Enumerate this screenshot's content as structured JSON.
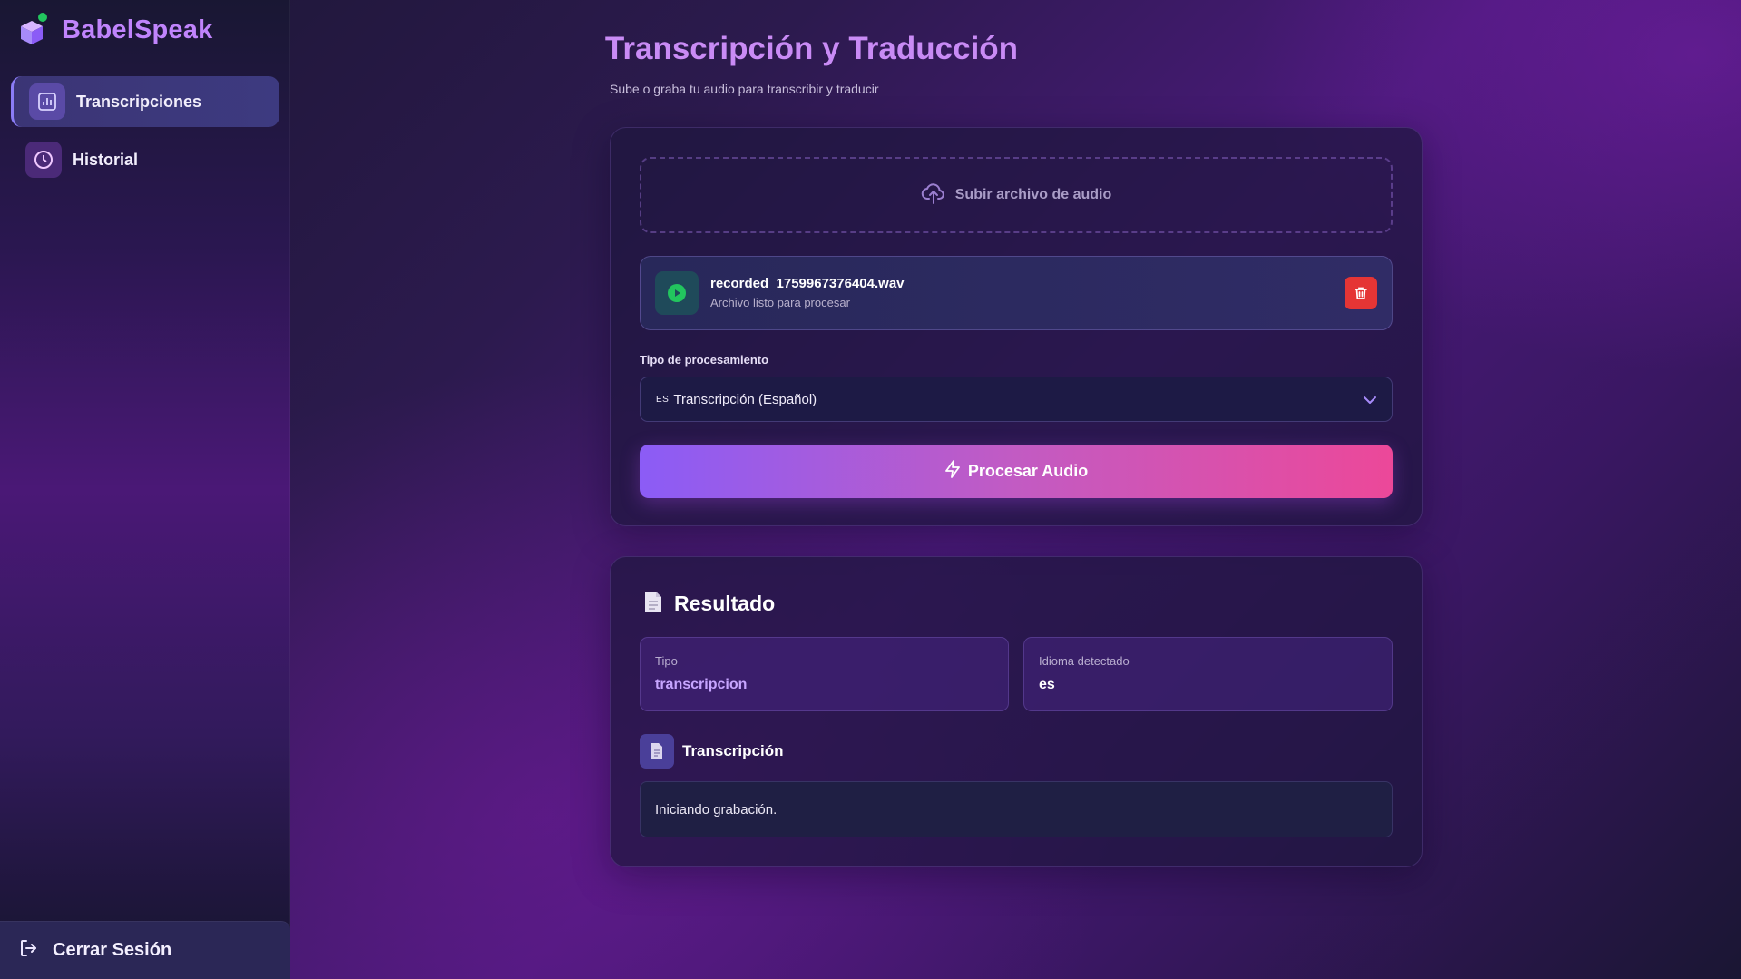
{
  "app": {
    "name": "BabelSpeak",
    "accent": "#c084fc"
  },
  "sidebar": {
    "items": [
      {
        "label": "Transcripciones",
        "icon": "bar-chart-icon",
        "active": true
      },
      {
        "label": "Historial",
        "icon": "clock-icon",
        "active": false
      }
    ],
    "logout_label": "Cerrar Sesión"
  },
  "header": {
    "title": "Transcripción y Traducción",
    "subtitle": "Sube o graba tu audio para transcribir y traducir"
  },
  "upload": {
    "label": "Subir archivo de audio",
    "icon": "upload-cloud-icon"
  },
  "file": {
    "name": "recorded_1759967376404.wav",
    "status": "Archivo listo para procesar"
  },
  "processing": {
    "label": "Tipo de procesamiento",
    "selected_flag": "ES",
    "selected_value": "Transcripción (Español)",
    "button_label": "Procesar Audio"
  },
  "result": {
    "title": "Resultado",
    "tipo_key": "Tipo",
    "tipo_value": "transcripcion",
    "idioma_key": "Idioma detectado",
    "idioma_value": "es",
    "transcription_title": "Transcripción",
    "transcription_text": "Iniciando grabación."
  }
}
